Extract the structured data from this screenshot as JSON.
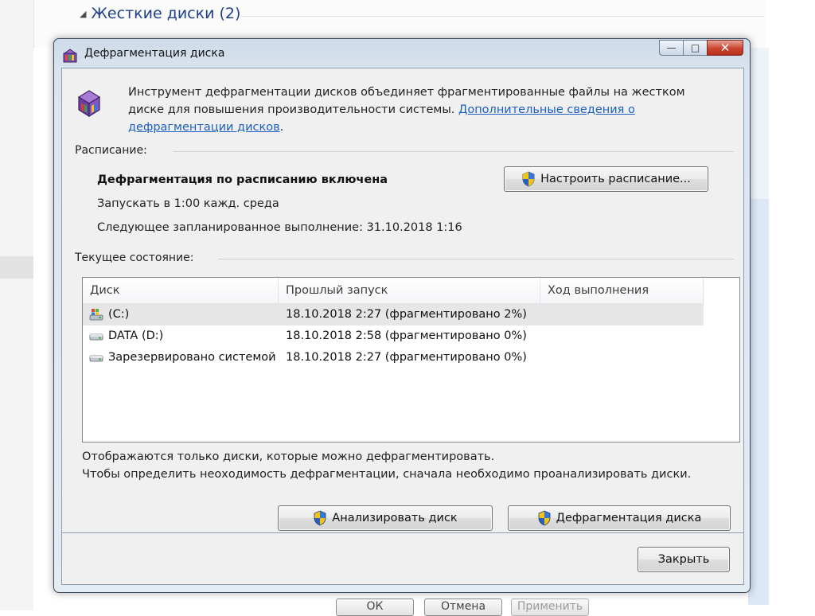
{
  "background": {
    "group_label": "Жесткие диски (2)",
    "buttons": {
      "ok": "ОК",
      "cancel": "Отмена",
      "apply": "Применить"
    }
  },
  "window": {
    "title": "Дефрагментация диска",
    "controls": {
      "minimize": "—",
      "maximize": "□",
      "close": "✕"
    }
  },
  "description": {
    "text": "Инструмент дефрагментации дисков объединяет фрагментированные файлы на жестком диске для повышения производительности системы.",
    "link": "Дополнительные сведения о дефрагментации дисков",
    "link_suffix": "."
  },
  "schedule": {
    "section_label": "Расписание:",
    "status": "Дефрагментация по расписанию включена",
    "run": "Запускать в 1:00 кажд. среда",
    "next_run": "Следующее запланированное выполнение: 31.10.2018 1:16",
    "configure_button": "Настроить расписание..."
  },
  "current_status": {
    "section_label": "Текущее состояние:",
    "columns": {
      "disk": "Диск",
      "last_run": "Прошлый запуск",
      "progress": "Ход выполнения"
    },
    "rows": [
      {
        "disk": "(C:)",
        "last_run": "18.10.2018 2:27 (фрагментировано 2%)",
        "progress": "",
        "icon": "system-drive-icon",
        "selected": true
      },
      {
        "disk": "DATA (D:)",
        "last_run": "18.10.2018 2:58 (фрагментировано 0%)",
        "progress": "",
        "icon": "drive-icon",
        "selected": false
      },
      {
        "disk": "Зарезервировано системой",
        "last_run": "18.10.2018 2:27 (фрагментировано 0%)",
        "progress": "",
        "icon": "drive-icon",
        "selected": false
      }
    ]
  },
  "notes": {
    "line1": "Отображаются только диски, которые можно дефрагментировать.",
    "line2": "Чтобы определить неоходимость  дефрагментации, сначала необходимо проанализировать диски."
  },
  "actions": {
    "analyze_button": "Анализировать диск",
    "defrag_button": "Дефрагментация диска",
    "close_button": "Закрыть"
  },
  "colors": {
    "link": "#1c5fbf",
    "selection": "#e6e6e6",
    "close_button_red": "#c9452e",
    "window_frame": "#dbe5f0"
  }
}
